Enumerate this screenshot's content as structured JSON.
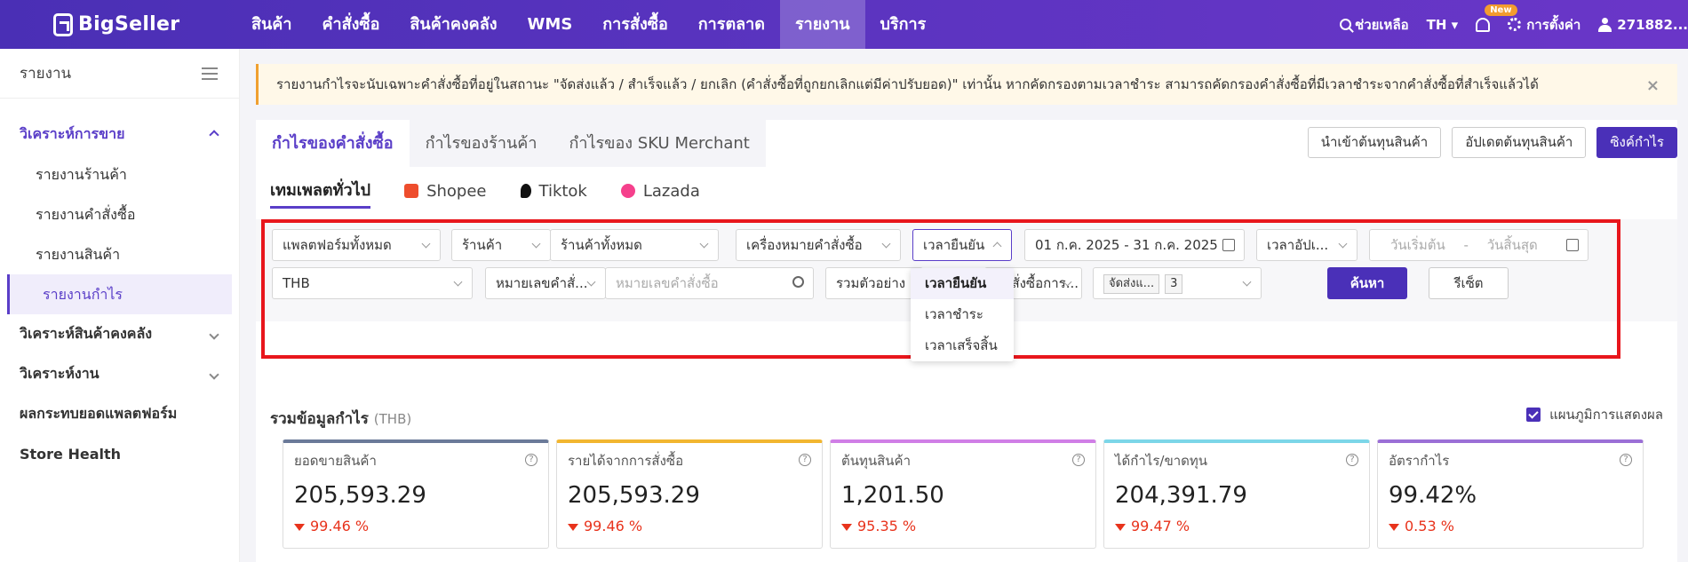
{
  "topnav": {
    "brand": "BigSeller",
    "items": [
      "สินค้า",
      "คำสั่งซื้อ",
      "สินค้าคงคลัง",
      "WMS",
      "การสั่งซื้อ",
      "การตลาด",
      "รายงาน",
      "บริการ"
    ],
    "active_index": 6,
    "help": "ช่วยเหลือ",
    "lang": "TH ▾",
    "new_badge": "New",
    "settings": "การตั้งค่า",
    "user": "271882..."
  },
  "sidebar": {
    "title": "รายงาน",
    "group_sales": "วิเคราะห์การขาย",
    "sub": [
      "รายงานร้านค้า",
      "รายงานคำสั่งซื้อ",
      "รายงานสินค้า",
      "รายงานกำไร"
    ],
    "group_inventory": "วิเคราะห์สินค้าคงคลัง",
    "group_work": "วิเคราะห์งาน",
    "platform_impact": "ผลกระทบยอดแพลตฟอร์ม",
    "store_health": "Store Health"
  },
  "notice": "รายงานกำไรจะนับเฉพาะคำสั่งซื้อที่อยู่ในสถานะ \"จัดส่งแล้ว / สำเร็จแล้ว / ยกเลิก (คำสั่งซื้อที่ถูกยกเลิกแต่มีค่าปรับยอด)\" เท่านั้น หากคัดกรองตามเวลาชำระ สามารถคัดกรองคำสั่งซื้อที่มีเวลาชำระจากคำสั่งซื้อที่สำเร็จแล้วได้",
  "tabs": [
    "กำไรของคำสั่งซื้อ",
    "กำไรของร้านค้า",
    "กำไรของ SKU Merchant"
  ],
  "buttons": {
    "import_cost": "นำเข้าต้นทุนสินค้า",
    "update_cost": "อัปเดตต้นทุนสินค้า",
    "sync_profit": "ซิงค์กำไร"
  },
  "subtabs": [
    "เทมเพลตทั่วไป",
    "Shopee",
    "Tiktok",
    "Lazada"
  ],
  "filters": {
    "platform": "แพลตฟอร์มทั้งหมด",
    "store_label": "ร้านค้า",
    "store": "ร้านค้าทั้งหมด",
    "order_mark": "เครื่องหมายคำสั่งซื้อ",
    "time_type": "เวลายืนยัน",
    "date_range": "01 ก.ค. 2025 - 31 ก.ค. 2025",
    "update_time": "เวลาอัปเ...",
    "start_date": "วันเริ่มต้น",
    "dash": "-",
    "end_date": "วันสิ้นสุด",
    "currency": "THB",
    "order_no_type": "หมายเลขคำสั่...",
    "order_no_placeholder": "หมายเลขคำสั่งซื้อ",
    "combine": "รวมตัวอย่าง",
    "order_type": "คำสั่งซื้อการ...",
    "status_tag": "จัดส่งแ...",
    "status_count": "3",
    "search": "ค้นหา",
    "reset": "รีเซ็ต"
  },
  "dropdown": [
    "เวลายืนยัน",
    "เวลาชำระ",
    "เวลาเสร็จสิ้น"
  ],
  "summary": {
    "title": "รวมข้อมูลกำไร",
    "currency": "(THB)",
    "chart_toggle": "แผนภูมิการแสดงผล"
  },
  "metrics": [
    {
      "label": "ยอดขายสินค้า",
      "value": "205,593.29",
      "change": "99.46 %",
      "color": "#6b7a99"
    },
    {
      "label": "รายได้จากการสั่งซื้อ",
      "value": "205,593.29",
      "change": "99.46 %",
      "color": "#f2b630"
    },
    {
      "label": "ต้นทุนสินค้า",
      "value": "1,201.50",
      "change": "95.35 %",
      "color": "#d07ee6"
    },
    {
      "label": "ได้กำไร/ขาดทุน",
      "value": "204,391.79",
      "change": "99.47 %",
      "color": "#7cd6e8"
    },
    {
      "label": "อัตรากำไร",
      "value": "99.42%",
      "change": "0.53 %",
      "color": "#9b6fd6"
    }
  ]
}
